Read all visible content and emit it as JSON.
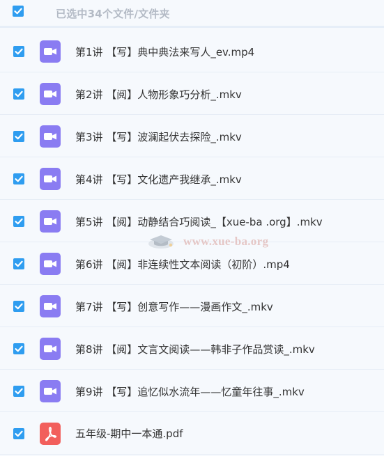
{
  "header": {
    "select_all_checked": true,
    "selection_text": "已选中34个文件/文件夹"
  },
  "files": [
    {
      "name": "第1讲 【写】典中典法来写人_ev.mp4",
      "type": "video",
      "checked": true
    },
    {
      "name": "第2讲 【阅】人物形象巧分析_.mkv",
      "type": "video",
      "checked": true
    },
    {
      "name": "第3讲 【写】波澜起伏去探险_.mkv",
      "type": "video",
      "checked": true
    },
    {
      "name": "第4讲 【写】文化遗产我继承_.mkv",
      "type": "video",
      "checked": true
    },
    {
      "name": "第5讲 【阅】动静结合巧阅读_【xue-ba .org】.mkv",
      "type": "video",
      "checked": true
    },
    {
      "name": "第6讲 【阅】非连续性文本阅读（初阶）.mp4",
      "type": "video",
      "checked": true
    },
    {
      "name": "第7讲 【写】创意写作——漫画作文_.mkv",
      "type": "video",
      "checked": true
    },
    {
      "name": "第8讲 【阅】文言文阅读——韩非子作品赏读_.mkv",
      "type": "video",
      "checked": true
    },
    {
      "name": "第9讲 【写】追忆似水流年——忆童年往事_.mkv",
      "type": "video",
      "checked": true
    },
    {
      "name": "五年级-期中一本通.pdf",
      "type": "pdf",
      "checked": true
    }
  ],
  "watermark": {
    "text": "www.xue-ba.org"
  },
  "colors": {
    "checkbox": "#2f9df0",
    "video_icon": "#8a7cf2",
    "pdf_icon": "#f25f5c",
    "background": "#f6f9fd",
    "text": "#333333",
    "header_text": "#b3bac5"
  }
}
